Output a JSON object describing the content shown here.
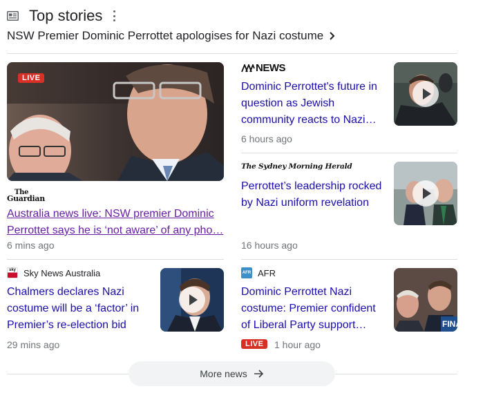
{
  "header": {
    "title": "Top stories",
    "icon": "news-icon",
    "menu_icon": "more-vert-icon"
  },
  "headline": {
    "text": "NSW Premier Dominic Perrottet apologises for Nazi costume",
    "icon": "chevron-right-icon"
  },
  "left": {
    "hero": {
      "badge": "LIVE",
      "publisher": "The Guardian",
      "publisher_logo_lines": [
        "The",
        "Guardian"
      ],
      "title": "Australia news live: NSW premier Dominic Perrottet says he is ‘not aware’ of any pho…",
      "time": "6 mins ago"
    },
    "story2": {
      "publisher": "Sky News Australia",
      "publisher_icon_text": "sky news",
      "title": "Chalmers declares Nazi costume will be a ‘factor’ in Premier’s re-election bid",
      "time": "29 mins ago"
    }
  },
  "right": {
    "story1": {
      "publisher": "ABC NEWS",
      "publisher_logo_text": "NEWS",
      "title": "Dominic Perrottet's future in question as Jewish community reacts to Nazi…",
      "time": "6 hours ago"
    },
    "story2": {
      "publisher": "The Sydney Morning Herald",
      "title": "Perrottet’s leadership rocked by Nazi uniform revelation",
      "time": "16 hours ago"
    },
    "story3": {
      "publisher": "AFR",
      "publisher_icon_text": "AFR",
      "title": "Dominic Perrottet Nazi costume: Premier confident of Liberal Party support…",
      "badge": "LIVE",
      "time": "1 hour ago",
      "thumb_overlay_text": "FINA"
    }
  },
  "more_news": {
    "label": "More news",
    "icon": "arrow-right-icon"
  },
  "colors": {
    "link": "#1a0dab",
    "visited": "#681da8",
    "live": "#d93025",
    "meta": "#70757a"
  }
}
